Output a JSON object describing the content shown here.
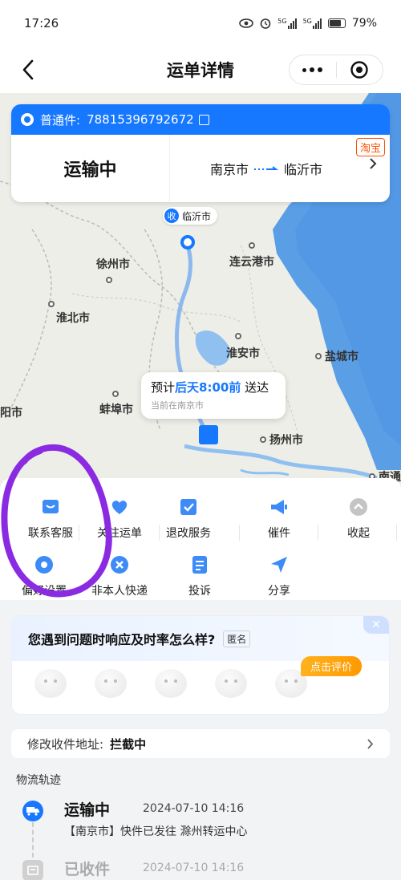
{
  "status_bar": {
    "time": "17:26",
    "net1": "5G",
    "net2": "5G",
    "battery": "79%"
  },
  "header": {
    "title": "运单详情"
  },
  "shipment": {
    "service": "普通件:",
    "tracking_no": "78815396792672",
    "status": "运输中",
    "from": "南京市",
    "to": "临沂市",
    "source_tag": "淘宝"
  },
  "map": {
    "receive_badge": "收",
    "receive_city": "临沂市",
    "cities": [
      {
        "name": "徐州市"
      },
      {
        "name": "连云港市"
      },
      {
        "name": "淮北市"
      },
      {
        "name": "淮安市"
      },
      {
        "name": "盐城市"
      },
      {
        "name": "蚌埠市"
      },
      {
        "name": "扬州市"
      },
      {
        "name": "阳市"
      },
      {
        "name": "南通"
      }
    ],
    "eta_prefix": "预计",
    "eta_highlight": "后天8:00前",
    "eta_suffix": "送达",
    "current_location": "当前在南京市"
  },
  "actions": {
    "row1": [
      {
        "label": "联系客服",
        "icon": "service-icon"
      },
      {
        "label": "关注运单",
        "icon": "heart-icon"
      },
      {
        "label": "退改服务",
        "icon": "check-icon"
      },
      {
        "label": "催件",
        "icon": "megaphone-icon"
      },
      {
        "label": "收起",
        "icon": "collapse-icon"
      }
    ],
    "row2": [
      {
        "label": "偏好设置",
        "icon": "settings-icon"
      },
      {
        "label": "非本人快递",
        "icon": "x-icon"
      },
      {
        "label": "投诉",
        "icon": "complaint-icon"
      },
      {
        "label": "分享",
        "icon": "share-icon"
      }
    ]
  },
  "rating": {
    "question": "您遇到问题时响应及时率怎么样?",
    "anonymous": "匿名",
    "cta": "点击评价"
  },
  "address": {
    "label": "修改收件地址:",
    "status": "拦截中"
  },
  "logistics": {
    "title": "物流轨迹",
    "events": [
      {
        "status": "运输中",
        "time": "2024-07-10 14:16",
        "desc": "【南京市】快件已发往 滁州转运中心"
      },
      {
        "status": "已收件",
        "time": "2024-07-10 14:16",
        "desc": ""
      }
    ]
  },
  "colors": {
    "brand": "#1677ff",
    "taobao": "#ff5000",
    "annotation": "#8a2be2"
  }
}
